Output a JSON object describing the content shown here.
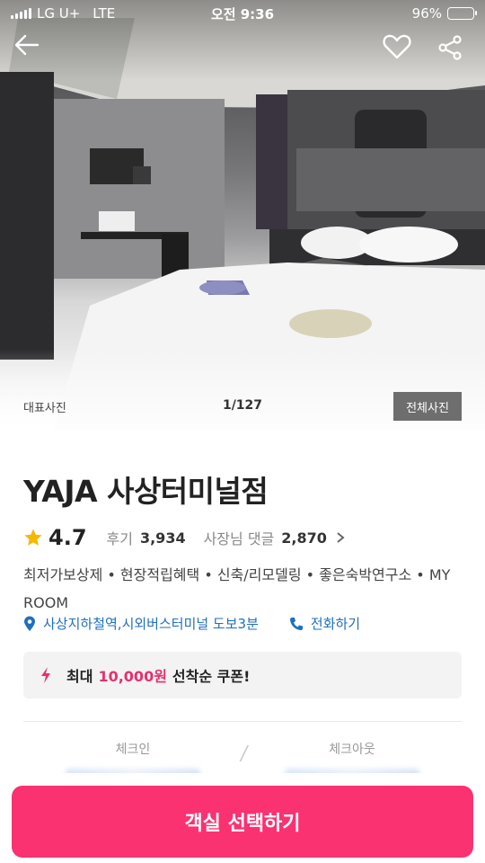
{
  "status_bar": {
    "carrier": "LG U+",
    "network": "LTE",
    "time": "오전 9:36",
    "battery_percent": "96%",
    "battery_level": 0.96
  },
  "hero": {
    "caption": "대표사진",
    "counter": "1/127",
    "all_photos_label": "전체사진"
  },
  "hotel": {
    "name": "YAJA 사상터미널점",
    "rating": "4.7",
    "reviews_label": "후기",
    "reviews_count": "3,934",
    "owner_replies_label": "사장님 댓글",
    "owner_replies_count": "2,870",
    "tags": "최저가보상제 • 현장적립혜택 • 신축/리모델링 • 좋은숙박연구소 • MY ROOM",
    "location": "사상지하철역,시외버스터미널 도보3분",
    "call_label": "전화하기"
  },
  "coupon": {
    "prefix": "최대",
    "amount": "10,000원",
    "suffix": "선착순 쿠폰!"
  },
  "dates": {
    "checkin_label": "체크인",
    "checkout_label": "체크아웃"
  },
  "cta": {
    "label": "객실 선택하기"
  },
  "colors": {
    "accent_pink": "#fa3271",
    "coupon_pink": "#e8306b",
    "link_blue": "#1f6fbf",
    "star_yellow": "#f5b800"
  },
  "icons": [
    "back-arrow-icon",
    "heart-icon",
    "share-icon",
    "star-icon",
    "chevron-right-icon",
    "location-pin-icon",
    "phone-icon",
    "lightning-icon"
  ]
}
